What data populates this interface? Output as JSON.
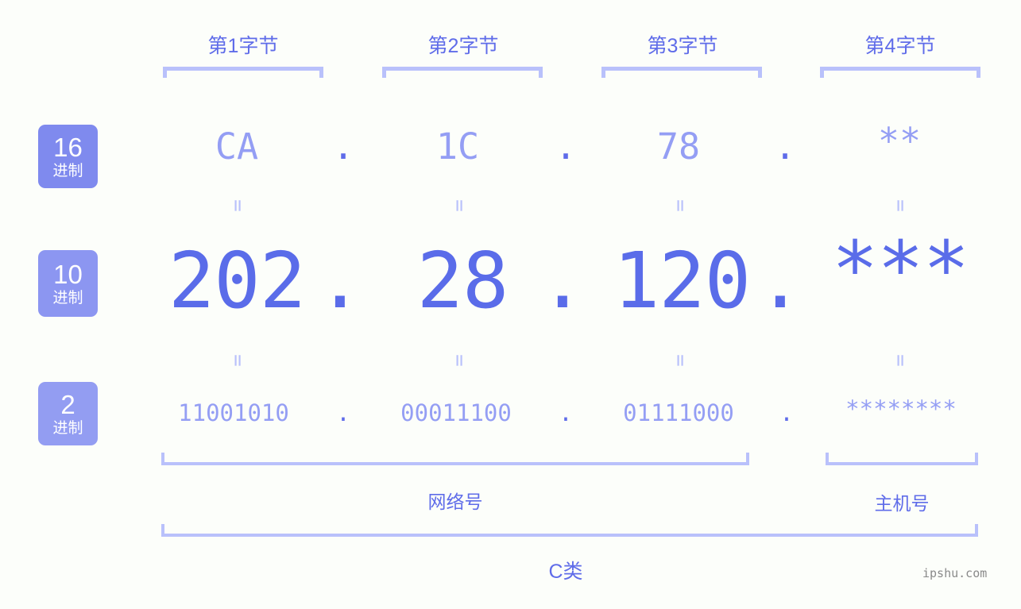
{
  "watermark": "ipshu.com",
  "byte_headers": [
    {
      "label": "第1字节"
    },
    {
      "label": "第2字节"
    },
    {
      "label": "第3字节"
    },
    {
      "label": "第4字节"
    }
  ],
  "rows": [
    {
      "key": "hex",
      "badge_number": "16",
      "badge_system": "进制",
      "values": [
        "CA",
        "1C",
        "78",
        "**"
      ],
      "separator": "."
    },
    {
      "key": "dec",
      "badge_number": "10",
      "badge_system": "进制",
      "values": [
        "202",
        "28",
        "120",
        "***"
      ],
      "separator": "."
    },
    {
      "key": "bin",
      "badge_number": "2",
      "badge_system": "进制",
      "values": [
        "11001010",
        "00011100",
        "01111000",
        "********"
      ],
      "separator": "."
    }
  ],
  "equals_symbol": "=",
  "regions": [
    {
      "label": "网络号"
    },
    {
      "label": "主机号"
    }
  ],
  "ip_class": "C类",
  "colors": {
    "background": "#fcfefa",
    "accent": "#5a6ce9",
    "accent_light": "#949ef4",
    "bracket": "#b9c1fb",
    "badge_bg": "#7f8aee",
    "badge_bg_light": "#939df2",
    "watermark": "#8a8a8a"
  }
}
